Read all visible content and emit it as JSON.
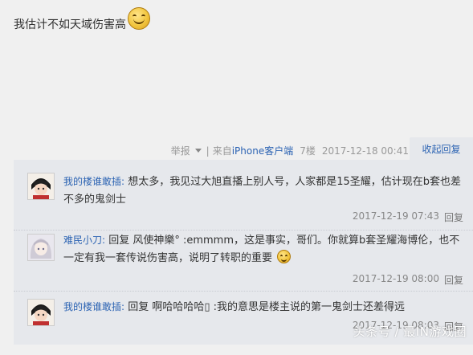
{
  "post": {
    "content": "我估计不如天域伤害高",
    "report_label": "举报",
    "separator": "|",
    "source_prefix": "来自",
    "device": "iPhone客户端",
    "floor": "7楼",
    "datetime": "2017-12-18 00:41",
    "collapse_label": "收起回复"
  },
  "replies": [
    {
      "user": "我的楼谁敢插:",
      "text": "想太多，我见过大旭直播上别人号，人家都是15圣耀，估计现在b套也差不多的鬼剑士",
      "datetime": "2017-12-19 07:43",
      "action": "回复"
    },
    {
      "user": "难民小刀:",
      "text": "回复 风使神樂° :emmmm，这是事实，哥们。你就算b套圣耀海博伦，也不一定有我一套传说伤害高，说明了转职的重要",
      "datetime": "2017-12-19 08:00",
      "action": "回复"
    },
    {
      "user": "我的楼谁敢插:",
      "text": "回复 啊哈哈哈哈▯ :我的意思是楼主说的第一鬼剑士还差得远",
      "datetime": "2017-12-19 08:03",
      "action": "回复"
    }
  ],
  "watermark": "头条号 / 最IN游戏圈",
  "colors": {
    "link": "#2d64b3",
    "panel": "#e6e8ec",
    "page": "#f0f0f0"
  },
  "icons": [
    "smiley-emoticon-icon",
    "dropdown-triangle-icon",
    "avatar"
  ]
}
